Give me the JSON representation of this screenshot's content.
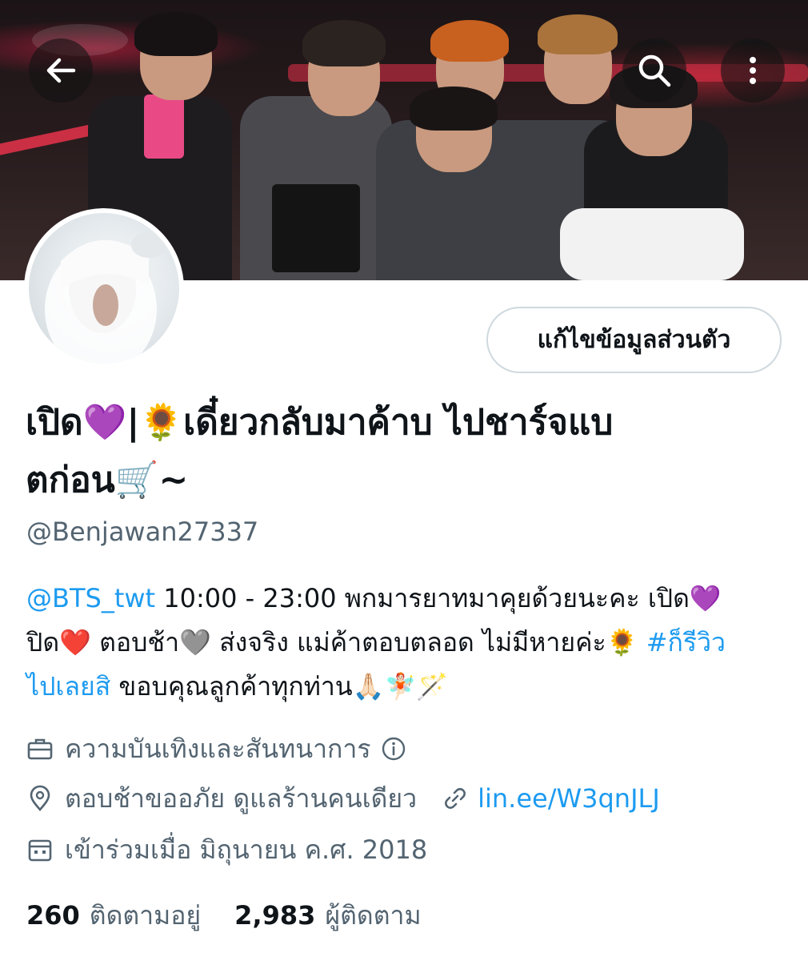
{
  "header": {
    "back_icon": "arrow-left-icon",
    "search_icon": "search-icon",
    "more_icon": "more-vertical-icon"
  },
  "profile": {
    "edit_button": "แก้ไขข้อมูลส่วนตัว",
    "display_name_line1": "เปิด💜|🌻เดี๋ยวกลับมาค้าบ ไปชาร์จแบ",
    "display_name_line2": "ตก่อน🛒~",
    "handle": "@Benjawan27337",
    "bio": {
      "mention": "@BTS_twt",
      "text1": " 10:00 - 23:00 พกมารยาทมาคุยด้วยนะคะ เปิด💜",
      "text2": "ปิด❤️ ตอบช้า🩶 ส่งจริง แม่ค้าตอบตลอด ไม่มีหายค่ะ🌻 ",
      "hashtag_part1": "#ก็รีวิว",
      "hashtag_part2": "ไปเลยสิ",
      "text3": " ขอบคุณลูกค้าทุกท่าน🙏🏻🧚🏻🪄"
    },
    "category": "ความบันเทิงและสันทนาการ",
    "location": "ตอบช้าขออภัย ดูแลร้านคนเดียว",
    "website": "lin.ee/W3qnJLJ",
    "joined": "เข้าร่วมเมื่อ มิถุนายน ค.ศ. 2018",
    "following_count": "260",
    "following_label": "ติดตามอยู่",
    "followers_count": "2,983",
    "followers_label": "ผู้ติดตาม"
  },
  "colors": {
    "link": "#1d9bf0",
    "secondary_text": "#536471",
    "border": "#cfd9de"
  }
}
